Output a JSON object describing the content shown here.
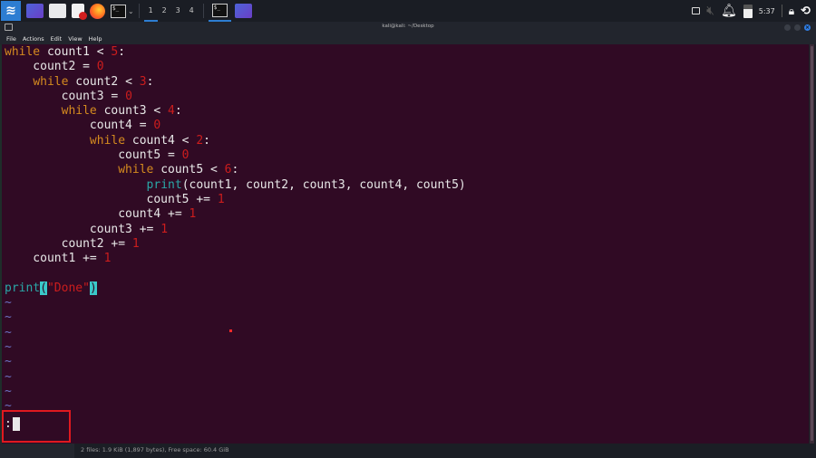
{
  "taskbar": {
    "launchers": [
      {
        "name": "kali-menu",
        "icon": "kali-dragon-icon"
      },
      {
        "name": "show-desktop",
        "icon": "desktop-icon"
      },
      {
        "name": "file-manager",
        "icon": "folder-icon"
      },
      {
        "name": "text-editor",
        "icon": "document-icon"
      },
      {
        "name": "firefox",
        "icon": "firefox-icon"
      },
      {
        "name": "terminal",
        "icon": "terminal-icon",
        "glyph": "$_"
      }
    ],
    "workspaces": [
      "1",
      "2",
      "3",
      "4"
    ],
    "active_workspace": "1",
    "tasks": [
      {
        "name": "terminal-task",
        "glyph": "$_",
        "active": true
      },
      {
        "name": "desktop-task",
        "active": false
      }
    ],
    "tray": {
      "clock": "5:37"
    }
  },
  "window": {
    "title": "kali@kali: ~/Desktop",
    "menu": [
      "File",
      "Actions",
      "Edit",
      "View",
      "Help"
    ]
  },
  "editor": {
    "lines": [
      [
        {
          "t": "while",
          "c": "kw"
        },
        {
          "t": " count1 < "
        },
        {
          "t": "5",
          "c": "num"
        },
        {
          "t": ":"
        }
      ],
      [
        {
          "t": "    count2 = "
        },
        {
          "t": "0",
          "c": "num"
        }
      ],
      [
        {
          "t": "    "
        },
        {
          "t": "while",
          "c": "kw"
        },
        {
          "t": " count2 < "
        },
        {
          "t": "3",
          "c": "num"
        },
        {
          "t": ":"
        }
      ],
      [
        {
          "t": "        count3 = "
        },
        {
          "t": "0",
          "c": "num"
        }
      ],
      [
        {
          "t": "        "
        },
        {
          "t": "while",
          "c": "kw"
        },
        {
          "t": " count3 < "
        },
        {
          "t": "4",
          "c": "num"
        },
        {
          "t": ":"
        }
      ],
      [
        {
          "t": "            count4 = "
        },
        {
          "t": "0",
          "c": "num"
        }
      ],
      [
        {
          "t": "            "
        },
        {
          "t": "while",
          "c": "kw"
        },
        {
          "t": " count4 < "
        },
        {
          "t": "2",
          "c": "num"
        },
        {
          "t": ":"
        }
      ],
      [
        {
          "t": "                count5 = "
        },
        {
          "t": "0",
          "c": "num"
        }
      ],
      [
        {
          "t": "                "
        },
        {
          "t": "while",
          "c": "kw"
        },
        {
          "t": " count5 < "
        },
        {
          "t": "6",
          "c": "num"
        },
        {
          "t": ":"
        }
      ],
      [
        {
          "t": "                    "
        },
        {
          "t": "print",
          "c": "fn"
        },
        {
          "t": "(count1, count2, count3, count4, count5)"
        }
      ],
      [
        {
          "t": "                    count5 += "
        },
        {
          "t": "1",
          "c": "num"
        }
      ],
      [
        {
          "t": "                count4 += "
        },
        {
          "t": "1",
          "c": "num"
        }
      ],
      [
        {
          "t": "            count3 += "
        },
        {
          "t": "1",
          "c": "num"
        }
      ],
      [
        {
          "t": "        count2 += "
        },
        {
          "t": "1",
          "c": "num"
        }
      ],
      [
        {
          "t": "    count1 += "
        },
        {
          "t": "1",
          "c": "num"
        }
      ],
      [],
      [
        {
          "t": "print",
          "c": "fn"
        },
        {
          "t": "(",
          "c": "paren"
        },
        {
          "t": "\"Done\"",
          "c": "str"
        },
        {
          "t": ")",
          "c": "paren"
        }
      ],
      [
        {
          "t": "~",
          "c": "tilde"
        }
      ],
      [
        {
          "t": "~",
          "c": "tilde"
        }
      ],
      [
        {
          "t": "~",
          "c": "tilde"
        }
      ],
      [
        {
          "t": "~",
          "c": "tilde"
        }
      ],
      [
        {
          "t": "~",
          "c": "tilde"
        }
      ],
      [
        {
          "t": "~",
          "c": "tilde"
        }
      ],
      [
        {
          "t": "~",
          "c": "tilde"
        }
      ],
      [
        {
          "t": "~",
          "c": "tilde"
        }
      ]
    ],
    "command_line": ":"
  },
  "statusbar": {
    "text": "2 files: 1.9 KiB (1,897 bytes), Free space: 60.4 GiB"
  }
}
